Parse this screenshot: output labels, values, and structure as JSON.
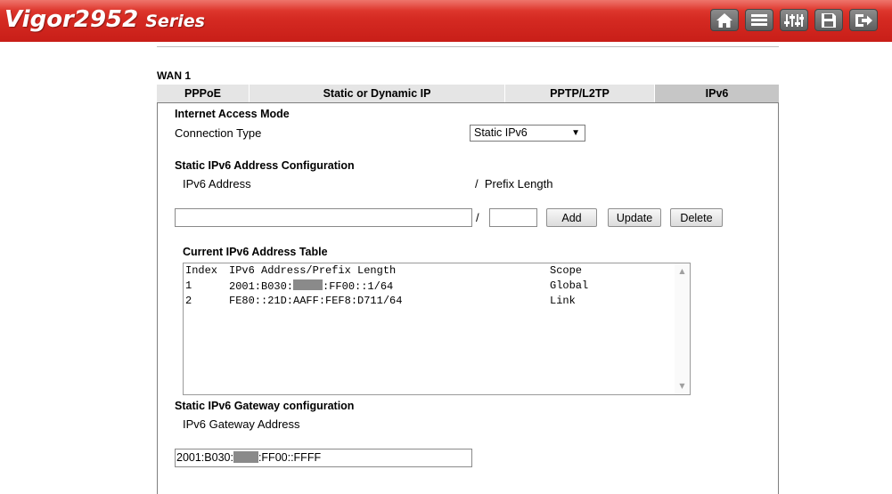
{
  "header": {
    "brand": "Vigor2952",
    "series": "Series",
    "brand_color": "#d52a22",
    "toolbar_icons": [
      "home-icon",
      "list-icon",
      "sliders-icon",
      "save-icon",
      "logout-icon"
    ]
  },
  "wan_title": "WAN 1",
  "tabs": [
    {
      "label": "PPPoE",
      "active": false
    },
    {
      "label": "Static or Dynamic IP",
      "active": false
    },
    {
      "label": "PPTP/L2TP",
      "active": false
    },
    {
      "label": "IPv6",
      "active": true
    }
  ],
  "internet_access": {
    "title": "Internet Access Mode",
    "connection_type_label": "Connection Type",
    "connection_type_value": "Static IPv6"
  },
  "static_config": {
    "title": "Static IPv6 Address Configuration",
    "address_label": "IPv6 Address",
    "prefix_label": "/  Prefix Length",
    "slash": "/",
    "address_value": "",
    "prefix_value": "",
    "add_label": "Add",
    "update_label": "Update",
    "delete_label": "Delete"
  },
  "address_table": {
    "title": "Current IPv6 Address Table",
    "columns": [
      "Index",
      "IPv6 Address/Prefix Length",
      "Scope"
    ],
    "rows": [
      {
        "index": "1",
        "address_prefix": "2001:B030:",
        "address_suffix": ":FF00::1/64",
        "masked": true,
        "scope": "Global"
      },
      {
        "index": "2",
        "address_prefix": "FE80::21D:AAFF:FEF8:D711/64",
        "address_suffix": "",
        "masked": false,
        "scope": "Link"
      }
    ]
  },
  "gateway": {
    "title": "Static IPv6 Gateway configuration",
    "address_label": "IPv6 Gateway Address",
    "value_prefix": "2001:B030:",
    "value_suffix": ":FF00::FFFF"
  }
}
